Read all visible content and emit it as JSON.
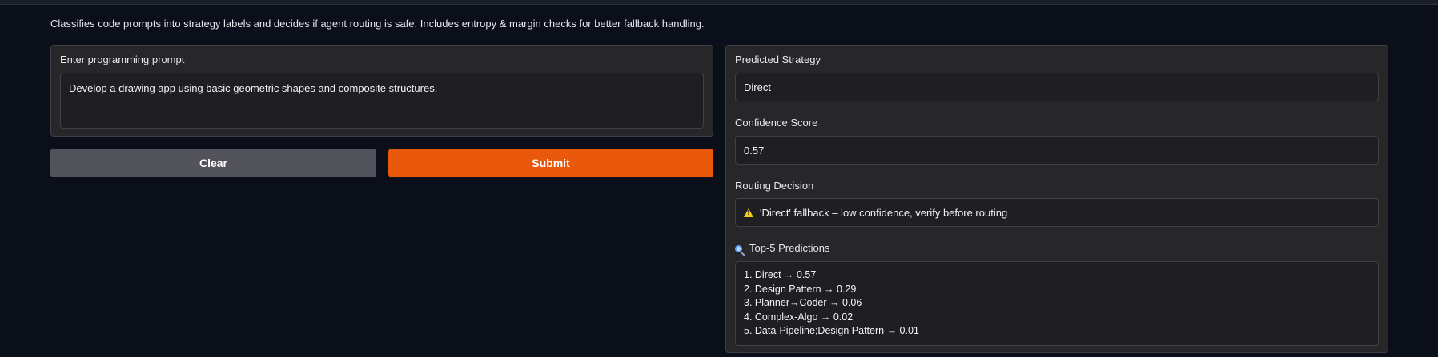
{
  "description": "Classifies code prompts into strategy labels and decides if agent routing is safe. Includes entropy & margin checks for better fallback handling.",
  "input": {
    "label": "Enter programming prompt",
    "value": "Develop a drawing app using basic geometric shapes and composite structures."
  },
  "buttons": {
    "clear_label": "Clear",
    "submit_label": "Submit"
  },
  "output": {
    "strategy_label": "Predicted Strategy",
    "strategy_value": "Direct",
    "confidence_label": "Confidence Score",
    "confidence_value": "0.57",
    "routing_label": "Routing Decision",
    "routing_value": "'Direct' fallback – low confidence, verify before routing",
    "top5_label": "Top-5 Predictions",
    "predictions": [
      "1. Direct → 0.57",
      "2. Design Pattern → 0.29",
      "3. Planner→Coder → 0.06",
      "4. Complex-Algo → 0.02",
      "5. Data-Pipeline;Design Pattern → 0.01"
    ]
  },
  "colors": {
    "background": "#0b0f19",
    "panel": "#27272a",
    "submit": "#ea580c",
    "clear": "#52525b",
    "warning": "#facc15"
  },
  "icons": [
    "warning-icon",
    "magnifier-icon"
  ]
}
